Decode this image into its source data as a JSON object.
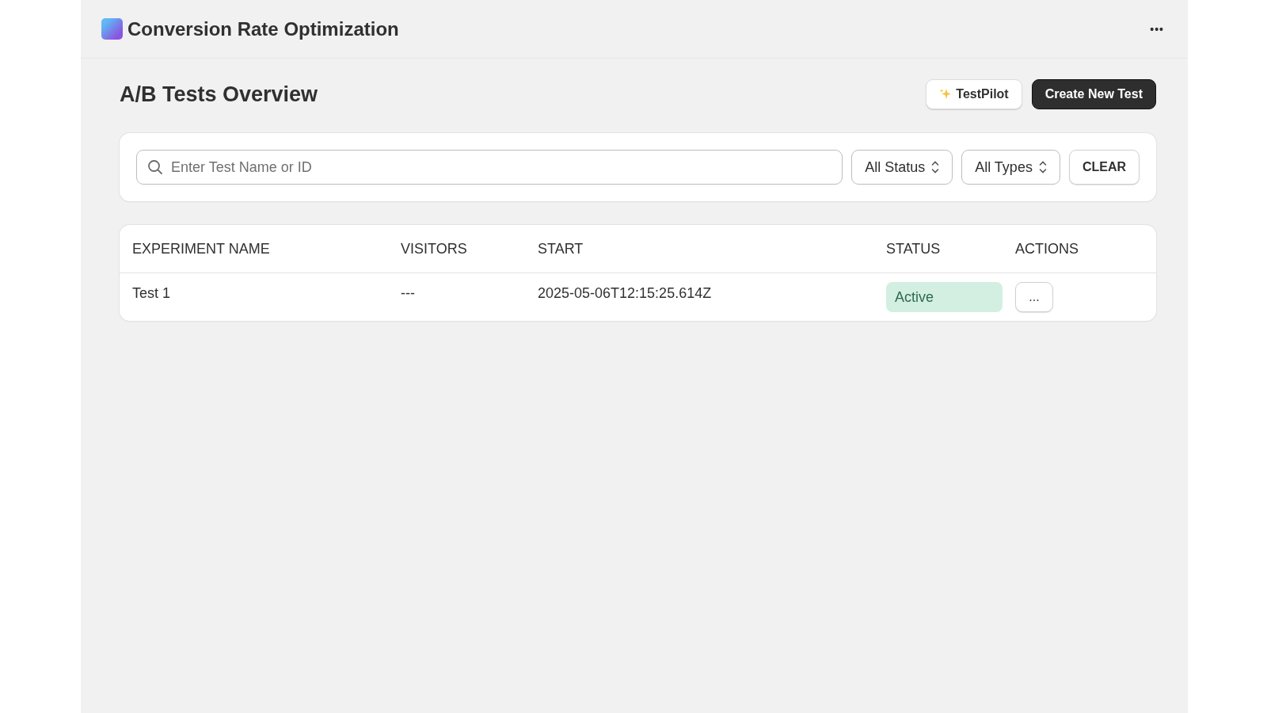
{
  "app": {
    "title": "Conversion Rate Optimization",
    "menu_label": "•••"
  },
  "page": {
    "heading": "A/B Tests Overview",
    "buttons": [
      {
        "label": "TestPilot",
        "kind": "secondary"
      },
      {
        "label": "Create New Test",
        "kind": "primary"
      }
    ]
  },
  "filters": {
    "search": {
      "placeholder": "Enter Test Name or ID"
    },
    "selects": [
      {
        "value": "All Status"
      },
      {
        "value": "All Types"
      }
    ],
    "clear_label": "CLEAR"
  },
  "table": {
    "columns": [
      "EXPERIMENT NAME",
      "VISITORS",
      "START",
      "STATUS",
      "ACTIONS"
    ],
    "rows": [
      {
        "name": "Test 1",
        "visitors": "---",
        "start": "2025-05-06T12:15:25.614Z",
        "status": {
          "label": "Active",
          "kind": "success"
        },
        "action_label": "..."
      }
    ]
  }
}
